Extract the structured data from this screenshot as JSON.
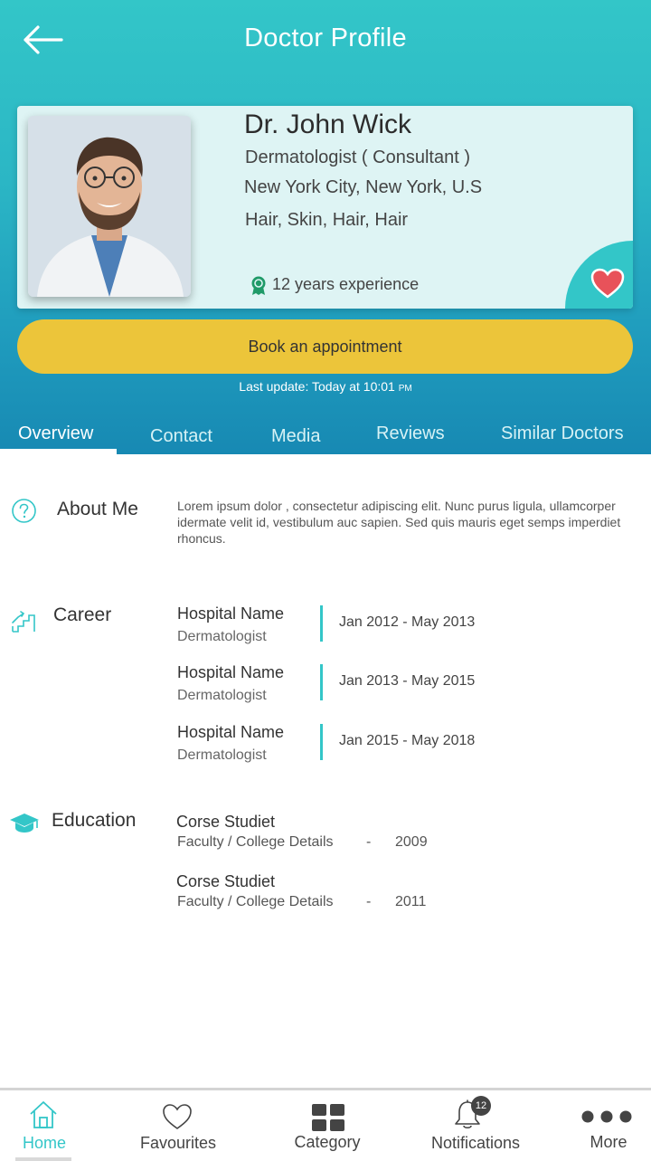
{
  "header": {
    "title": "Doctor Profile"
  },
  "doctor": {
    "name": "Dr. John Wick",
    "specialty": "Dermatologist  ( Consultant )",
    "location": "New York City, New York, U.S",
    "tags": "Hair, Skin, Hair, Hair",
    "experience": "12 years experience"
  },
  "actions": {
    "book_label": "Book an appointment",
    "last_update_label": "Last update: Today at 10:01",
    "last_update_suffix": "PM"
  },
  "tabs": [
    {
      "label": "Overview",
      "active": true
    },
    {
      "label": "Contact"
    },
    {
      "label": "Media"
    },
    {
      "label": "Reviews"
    },
    {
      "label": "Similar Doctors"
    }
  ],
  "about": {
    "title": "About Me",
    "text": "Lorem ipsum dolor , consectetur adipiscing elit. Nunc purus ligula, ullamcorper idermate  velit id, vestibulum auc sapien. Sed quis mauris eget semps imperdiet rhoncus."
  },
  "career": {
    "title": "Career",
    "items": [
      {
        "hospital": "Hospital Name",
        "role": "Dermatologist",
        "period": "Jan 2012 - May 2013"
      },
      {
        "hospital": "Hospital Name",
        "role": "Dermatologist",
        "period": "Jan 2013 - May 2015"
      },
      {
        "hospital": "Hospital Name",
        "role": "Dermatologist",
        "period": "Jan 2015 - May 2018"
      }
    ]
  },
  "education": {
    "title": "Education",
    "items": [
      {
        "course": "Corse Studiet",
        "detail": "Faculty / College Details",
        "sep": "-",
        "year": "2009"
      },
      {
        "course": "Corse Studiet",
        "detail": "Faculty / College Details",
        "sep": "-",
        "year": "2011"
      }
    ]
  },
  "bottom_nav": {
    "items": [
      {
        "label": "Home",
        "icon": "home-icon",
        "active": true
      },
      {
        "label": "Favourites",
        "icon": "heart-outline-icon"
      },
      {
        "label": "Category",
        "icon": "grid-icon"
      },
      {
        "label": "Notifications",
        "icon": "bell-icon",
        "badge": "12"
      },
      {
        "label": "More",
        "icon": "more-dots-icon"
      }
    ]
  },
  "colors": {
    "accent": "#33c6c8",
    "button": "#ecc53a",
    "heart": "#e8525a",
    "card_bg": "#def4f4"
  }
}
